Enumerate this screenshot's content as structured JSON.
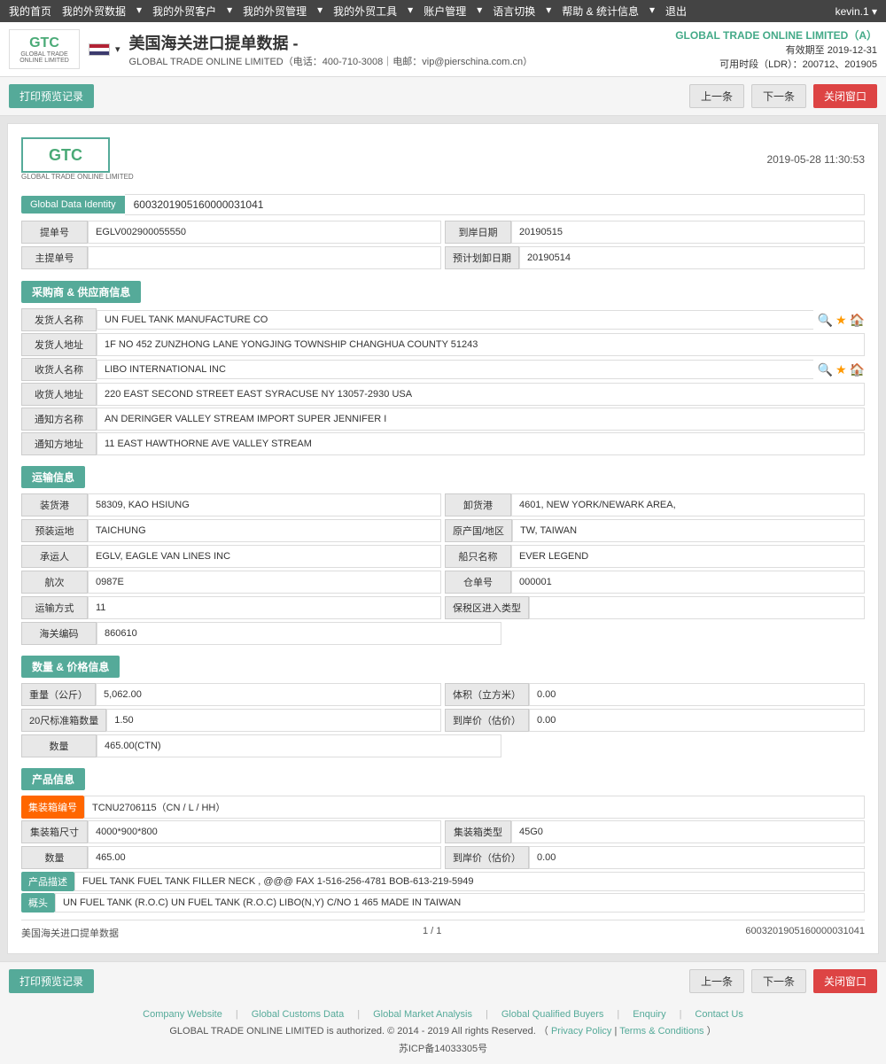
{
  "topnav": {
    "home": "我的首页",
    "foreign_trade": "我的外贸数据",
    "foreign_client": "我的外贸客户",
    "foreign_admin": "我的外贸管理",
    "foreign_tool": "我的外贸工具",
    "account_mgmt": "账户管理",
    "language": "语言切换",
    "help": "帮助 & 统计信息",
    "exit": "退出",
    "user": "kevin.1"
  },
  "header": {
    "title": "美国海关进口提单数据 -",
    "contact": "GLOBAL TRADE ONLINE LIMITED（电话：400-710-3008｜电邮：vip@pierschina.com.cn）",
    "company": "GLOBAL TRADE ONLINE LIMITED（A）",
    "expire": "有效期至 2019-12-31",
    "ldr": "可用时段（LDR）：200712、201905"
  },
  "toolbar": {
    "print_btn": "打印预览记录",
    "prev_btn": "上一条",
    "next_btn": "下一条",
    "close_btn": "关闭窗口"
  },
  "doc": {
    "datetime": "2019-05-28 11:30:53",
    "global_data_identity_label": "Global Data Identity",
    "global_data_identity_value": "6003201905160000031041",
    "bill_no_label": "提单号",
    "bill_no_value": "EGLV002900055550",
    "arrival_date_label": "到岸日期",
    "arrival_date_value": "20190515",
    "master_bill_label": "主提单号",
    "master_bill_value": "",
    "planned_arrival_label": "预计划卸日期",
    "planned_arrival_value": "20190514",
    "section_supplier": "采购商 & 供应商信息",
    "shipper_name_label": "发货人名称",
    "shipper_name_value": "UN FUEL TANK MANUFACTURE CO",
    "shipper_addr_label": "发货人地址",
    "shipper_addr_value": "1F NO 452 ZUNZHONG LANE YONGJING TOWNSHIP CHANGHUA COUNTY 51243",
    "receiver_name_label": "收货人名称",
    "receiver_name_value": "LIBO INTERNATIONAL INC",
    "receiver_addr_label": "收货人地址",
    "receiver_addr_value": "220 EAST SECOND STREET EAST SYRACUSE NY 13057-2930 USA",
    "notify_name_label": "通知方名称",
    "notify_name_value": "AN DERINGER VALLEY STREAM IMPORT SUPER JENNIFER I",
    "notify_addr_label": "通知方地址",
    "notify_addr_value": "11 EAST HAWTHORNE AVE VALLEY STREAM",
    "section_transport": "运输信息",
    "load_port_label": "装货港",
    "load_port_value": "58309, KAO HSIUNG",
    "unload_port_label": "卸货港",
    "unload_port_value": "4601, NEW YORK/NEWARK AREA,",
    "pre_dest_label": "预装运地",
    "pre_dest_value": "TAICHUNG",
    "origin_label": "原产国/地区",
    "origin_value": "TW, TAIWAN",
    "carrier_label": "承运人",
    "carrier_value": "EGLV, EAGLE VAN LINES INC",
    "vessel_label": "船只名称",
    "vessel_value": "EVER LEGEND",
    "voyage_label": "航次",
    "voyage_value": "0987E",
    "warehouse_label": "仓单号",
    "warehouse_value": "000001",
    "transport_mode_label": "运输方式",
    "transport_mode_value": "11",
    "tax_zone_label": "保税区进入类型",
    "tax_zone_value": "",
    "customs_code_label": "海关编码",
    "customs_code_value": "860610",
    "section_quantity": "数量 & 价格信息",
    "weight_label": "重量（公斤）",
    "weight_value": "5,062.00",
    "volume_label": "体积（立方米）",
    "volume_value": "0.00",
    "teu20_label": "20尺标准箱数量",
    "teu20_value": "1.50",
    "arrival_price_label": "到岸价（估价）",
    "arrival_price_value": "0.00",
    "qty_label": "数量",
    "qty_value": "465.00(CTN)",
    "section_product": "产品信息",
    "container_no_label": "集装箱编号",
    "container_no_value": "TCNU2706115（CN / L / HH）",
    "container_size_label": "集装箱尺寸",
    "container_size_value": "4000*900*800",
    "container_type_label": "集装箱类型",
    "container_type_value": "45G0",
    "prod_qty_label": "数量",
    "prod_qty_value": "465.00",
    "prod_price_label": "到岸价（估价）",
    "prod_price_value": "0.00",
    "product_desc_label": "产品描述",
    "product_desc_value": "FUEL TANK FUEL TANK FILLER NECK , @@@ FAX 1-516-256-4781 BOB-613-219-5949",
    "header_label": "概头",
    "header_value": "UN FUEL TANK (R.O.C) UN FUEL TANK (R.O.C) LIBO(N,Y) C/NO 1 465 MADE IN TAIWAN",
    "doc_footer_title": "美国海关进口提单数据",
    "doc_footer_page": "1 / 1",
    "doc_footer_id": "6003201905160000031041"
  },
  "footer": {
    "icp": "苏ICP备14033305号",
    "links": [
      "Company Website",
      "Global Customs Data",
      "Global Market Analysis",
      "Global Qualified Buyers",
      "Enquiry",
      "Contact Us"
    ],
    "copyright": "GLOBAL TRADE ONLINE LIMITED is authorized. © 2014 - 2019 All rights Reserved.",
    "privacy": "Privacy Policy",
    "terms": "Terms & Conditions"
  }
}
